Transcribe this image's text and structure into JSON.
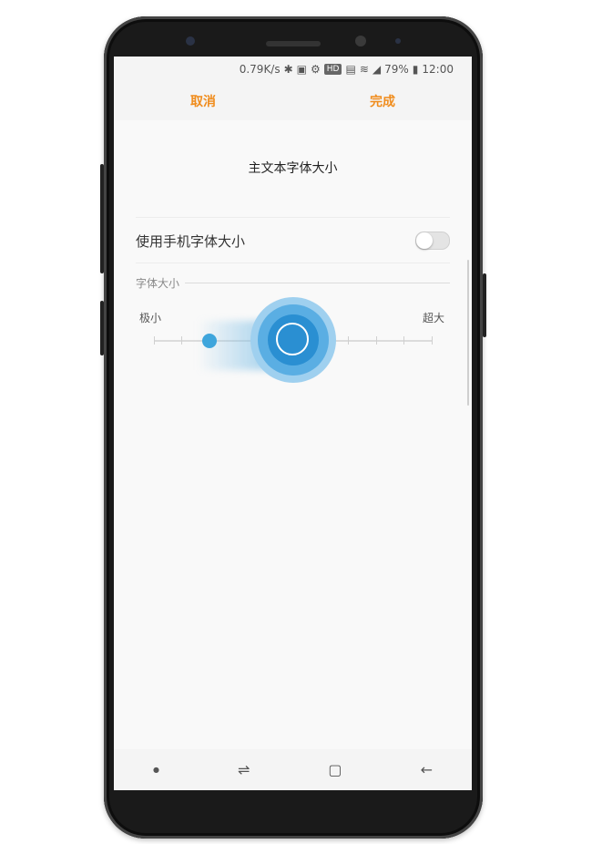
{
  "status_bar": {
    "net_speed": "0.79K/s",
    "icons": [
      "bluetooth-icon",
      "nfc-icon",
      "settings-icon",
      "hd-icon",
      "sim-icon",
      "wifi-icon",
      "signal-icon"
    ],
    "hd_badge": "HD",
    "battery": "79%",
    "time": "12:00"
  },
  "action_bar": {
    "cancel": "取消",
    "done": "完成",
    "accent_color": "#f08c1c"
  },
  "page_title": "主文本字体大小",
  "use_phone_font": {
    "label": "使用手机字体大小",
    "enabled": false
  },
  "font_size_section": {
    "label": "字体大小",
    "min_label": "极小",
    "max_label": "超大",
    "tick_count": 9,
    "selected_index": 2,
    "slider_color": "#2a8fd2"
  },
  "nav_bar": {
    "icons": [
      "recents-dot-icon",
      "recent-apps-icon",
      "home-icon",
      "back-icon"
    ]
  }
}
